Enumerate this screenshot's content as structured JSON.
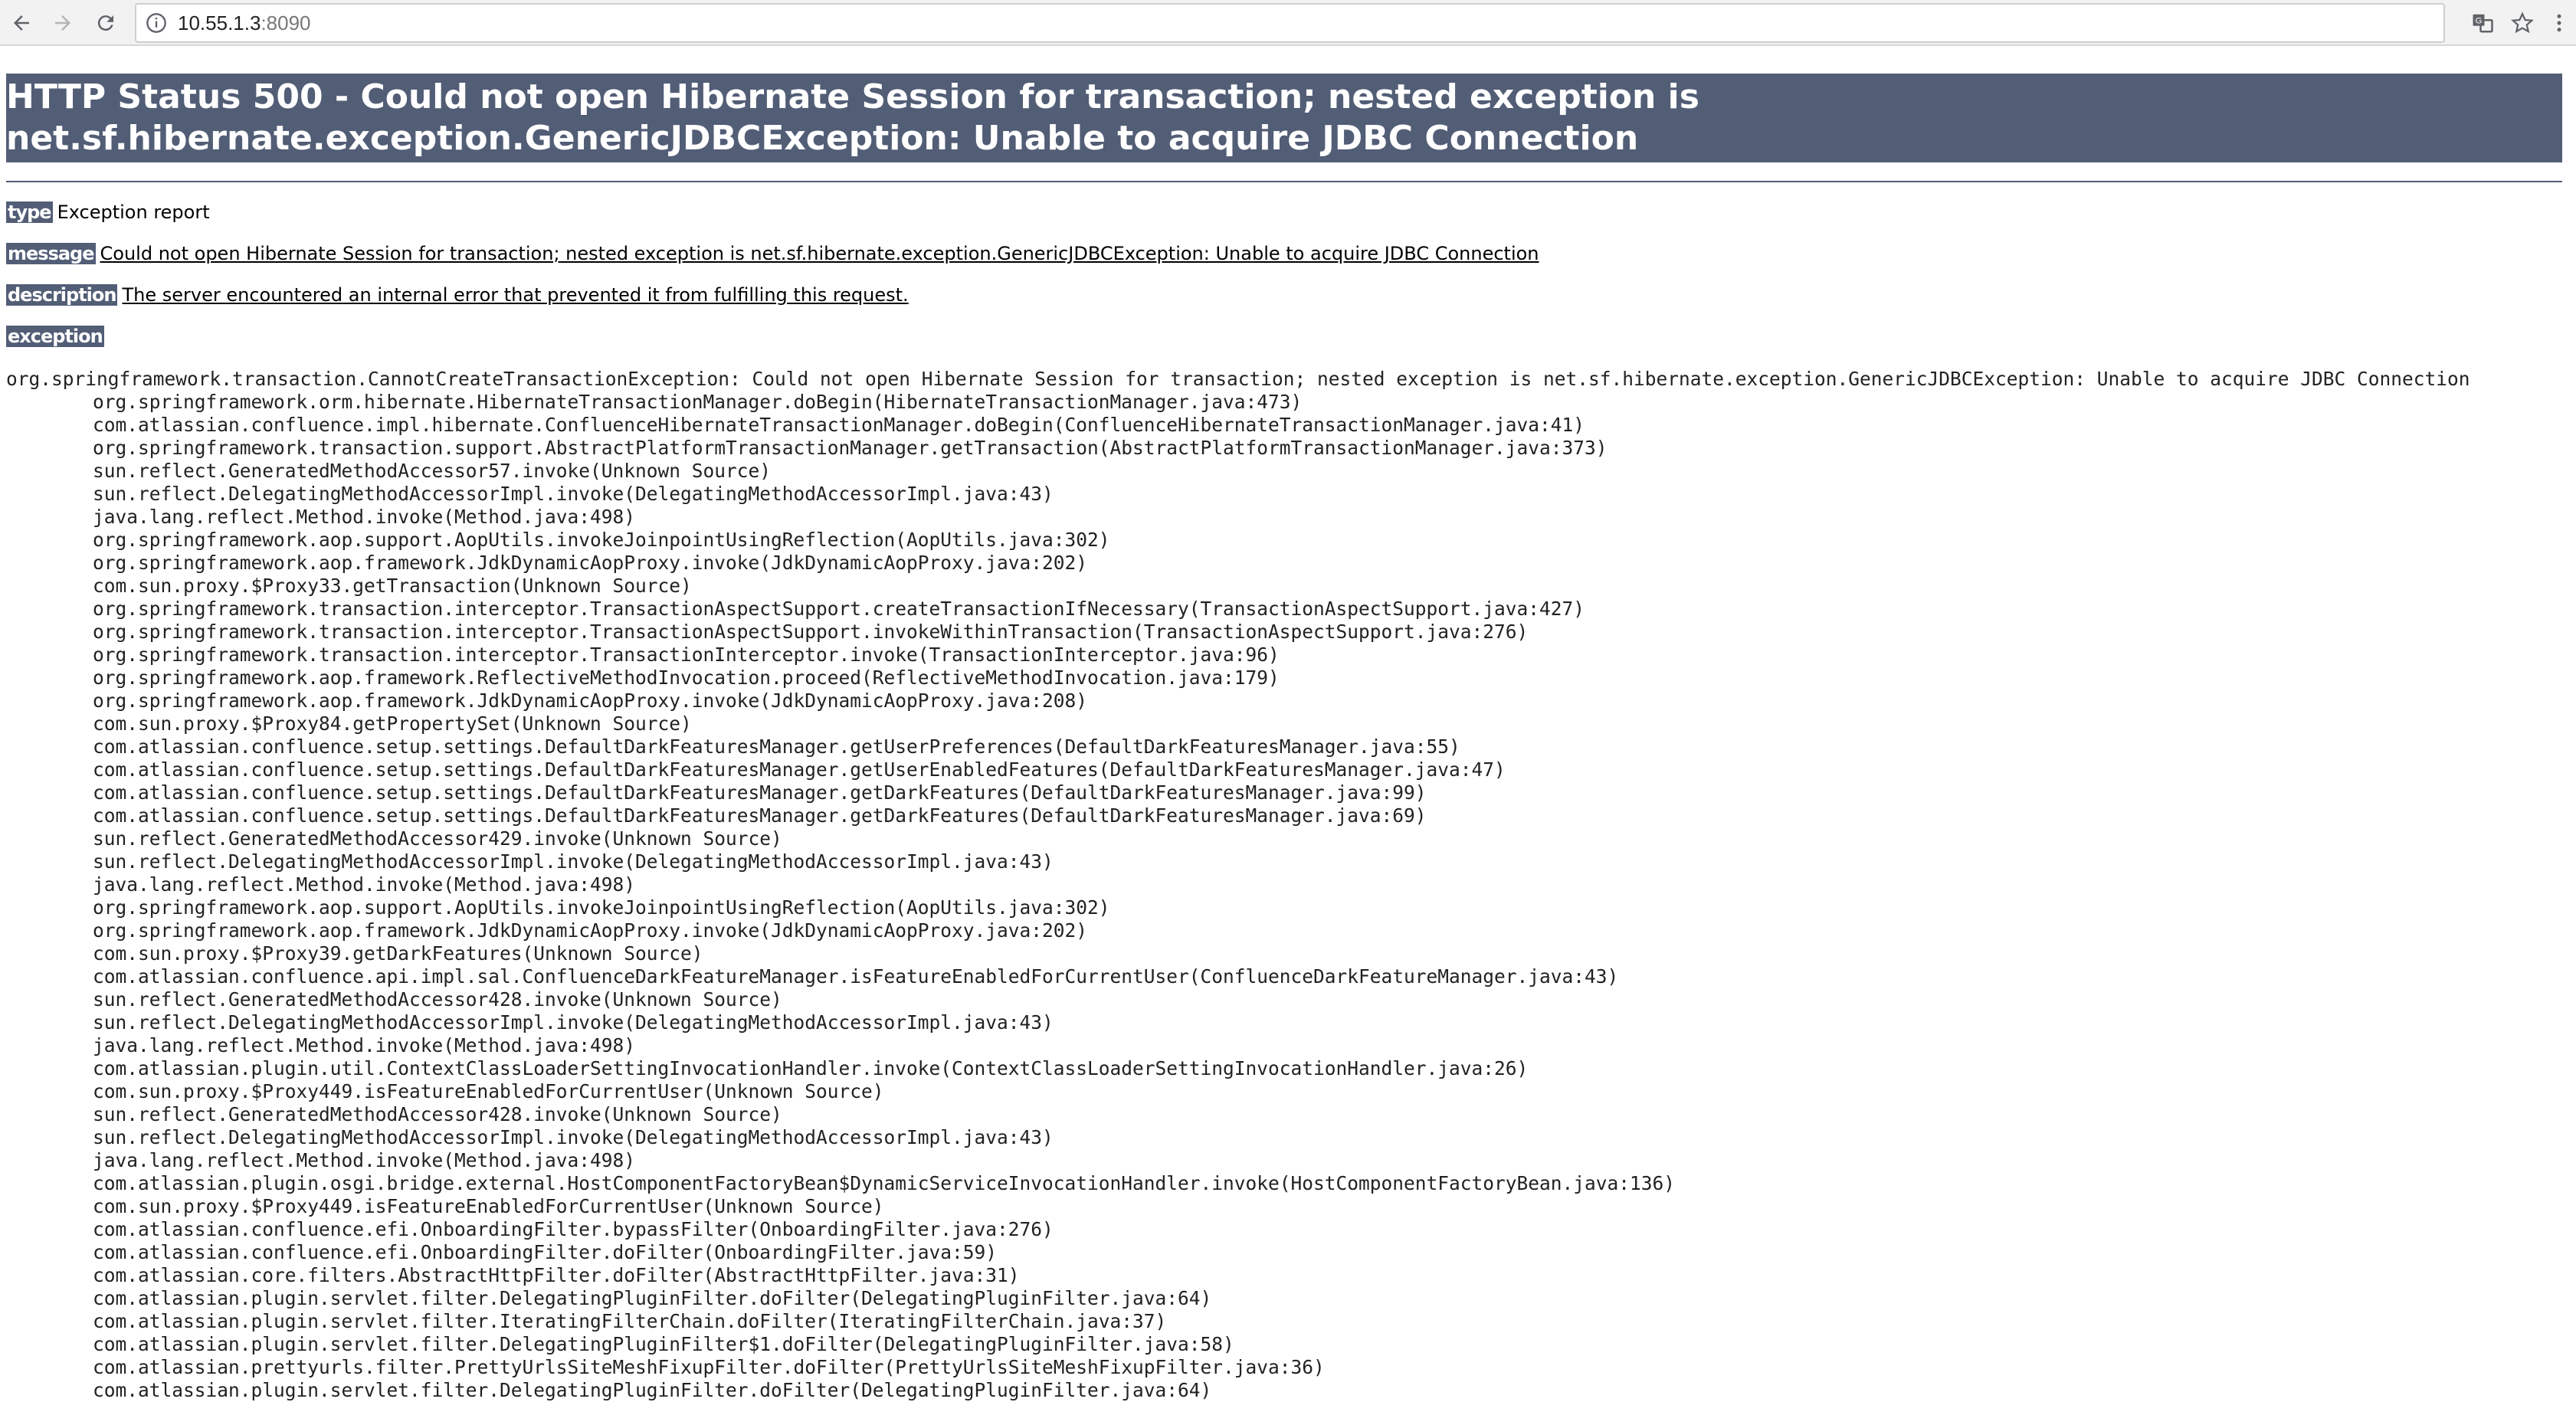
{
  "browser": {
    "url_host": "10.55.1.3",
    "url_port": ":8090",
    "icons": [
      "back-icon",
      "forward-icon",
      "reload-icon",
      "info-icon",
      "translate-icon",
      "bookmark-star-icon",
      "menu-icon"
    ]
  },
  "page": {
    "title": "HTTP Status 500 - Could not open Hibernate Session for transaction; nested exception is net.sf.hibernate.exception.GenericJDBCException: Unable to acquire JDBC Connection",
    "type_label": "type",
    "type_value": "Exception report",
    "message_label": "message",
    "message_value": "Could not open Hibernate Session for transaction; nested exception is net.sf.hibernate.exception.GenericJDBCException: Unable to acquire JDBC Connection",
    "description_label": "description",
    "description_value": "The server encountered an internal error that prevented it from fulfilling this request.",
    "exception_label": "exception",
    "exception_head": "org.springframework.transaction.CannotCreateTransactionException: Could not open Hibernate Session for transaction; nested exception is net.sf.hibernate.exception.GenericJDBCException: Unable to acquire JDBC Connection",
    "stack": [
      "org.springframework.orm.hibernate.HibernateTransactionManager.doBegin(HibernateTransactionManager.java:473)",
      "com.atlassian.confluence.impl.hibernate.ConfluenceHibernateTransactionManager.doBegin(ConfluenceHibernateTransactionManager.java:41)",
      "org.springframework.transaction.support.AbstractPlatformTransactionManager.getTransaction(AbstractPlatformTransactionManager.java:373)",
      "sun.reflect.GeneratedMethodAccessor57.invoke(Unknown Source)",
      "sun.reflect.DelegatingMethodAccessorImpl.invoke(DelegatingMethodAccessorImpl.java:43)",
      "java.lang.reflect.Method.invoke(Method.java:498)",
      "org.springframework.aop.support.AopUtils.invokeJoinpointUsingReflection(AopUtils.java:302)",
      "org.springframework.aop.framework.JdkDynamicAopProxy.invoke(JdkDynamicAopProxy.java:202)",
      "com.sun.proxy.$Proxy33.getTransaction(Unknown Source)",
      "org.springframework.transaction.interceptor.TransactionAspectSupport.createTransactionIfNecessary(TransactionAspectSupport.java:427)",
      "org.springframework.transaction.interceptor.TransactionAspectSupport.invokeWithinTransaction(TransactionAspectSupport.java:276)",
      "org.springframework.transaction.interceptor.TransactionInterceptor.invoke(TransactionInterceptor.java:96)",
      "org.springframework.aop.framework.ReflectiveMethodInvocation.proceed(ReflectiveMethodInvocation.java:179)",
      "org.springframework.aop.framework.JdkDynamicAopProxy.invoke(JdkDynamicAopProxy.java:208)",
      "com.sun.proxy.$Proxy84.getPropertySet(Unknown Source)",
      "com.atlassian.confluence.setup.settings.DefaultDarkFeaturesManager.getUserPreferences(DefaultDarkFeaturesManager.java:55)",
      "com.atlassian.confluence.setup.settings.DefaultDarkFeaturesManager.getUserEnabledFeatures(DefaultDarkFeaturesManager.java:47)",
      "com.atlassian.confluence.setup.settings.DefaultDarkFeaturesManager.getDarkFeatures(DefaultDarkFeaturesManager.java:99)",
      "com.atlassian.confluence.setup.settings.DefaultDarkFeaturesManager.getDarkFeatures(DefaultDarkFeaturesManager.java:69)",
      "sun.reflect.GeneratedMethodAccessor429.invoke(Unknown Source)",
      "sun.reflect.DelegatingMethodAccessorImpl.invoke(DelegatingMethodAccessorImpl.java:43)",
      "java.lang.reflect.Method.invoke(Method.java:498)",
      "org.springframework.aop.support.AopUtils.invokeJoinpointUsingReflection(AopUtils.java:302)",
      "org.springframework.aop.framework.JdkDynamicAopProxy.invoke(JdkDynamicAopProxy.java:202)",
      "com.sun.proxy.$Proxy39.getDarkFeatures(Unknown Source)",
      "com.atlassian.confluence.api.impl.sal.ConfluenceDarkFeatureManager.isFeatureEnabledForCurrentUser(ConfluenceDarkFeatureManager.java:43)",
      "sun.reflect.GeneratedMethodAccessor428.invoke(Unknown Source)",
      "sun.reflect.DelegatingMethodAccessorImpl.invoke(DelegatingMethodAccessorImpl.java:43)",
      "java.lang.reflect.Method.invoke(Method.java:498)",
      "com.atlassian.plugin.util.ContextClassLoaderSettingInvocationHandler.invoke(ContextClassLoaderSettingInvocationHandler.java:26)",
      "com.sun.proxy.$Proxy449.isFeatureEnabledForCurrentUser(Unknown Source)",
      "sun.reflect.GeneratedMethodAccessor428.invoke(Unknown Source)",
      "sun.reflect.DelegatingMethodAccessorImpl.invoke(DelegatingMethodAccessorImpl.java:43)",
      "java.lang.reflect.Method.invoke(Method.java:498)",
      "com.atlassian.plugin.osgi.bridge.external.HostComponentFactoryBean$DynamicServiceInvocationHandler.invoke(HostComponentFactoryBean.java:136)",
      "com.sun.proxy.$Proxy449.isFeatureEnabledForCurrentUser(Unknown Source)",
      "com.atlassian.confluence.efi.OnboardingFilter.bypassFilter(OnboardingFilter.java:276)",
      "com.atlassian.confluence.efi.OnboardingFilter.doFilter(OnboardingFilter.java:59)",
      "com.atlassian.core.filters.AbstractHttpFilter.doFilter(AbstractHttpFilter.java:31)",
      "com.atlassian.plugin.servlet.filter.DelegatingPluginFilter.doFilter(DelegatingPluginFilter.java:64)",
      "com.atlassian.plugin.servlet.filter.IteratingFilterChain.doFilter(IteratingFilterChain.java:37)",
      "com.atlassian.plugin.servlet.filter.DelegatingPluginFilter$1.doFilter(DelegatingPluginFilter.java:58)",
      "com.atlassian.prettyurls.filter.PrettyUrlsSiteMeshFixupFilter.doFilter(PrettyUrlsSiteMeshFixupFilter.java:36)",
      "com.atlassian.plugin.servlet.filter.DelegatingPluginFilter.doFilter(DelegatingPluginFilter.java:64)"
    ]
  }
}
